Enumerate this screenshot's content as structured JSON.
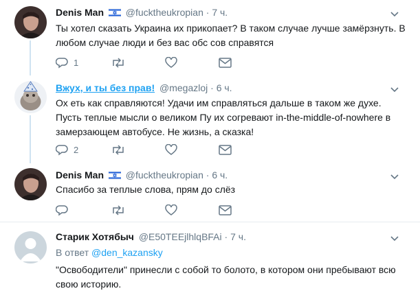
{
  "tweets": [
    {
      "name": "Denis Man",
      "handle": "@fucktheukropian",
      "sep": "·",
      "time": "7 ч.",
      "text": "Ты хотел сказать Украина их прикопает? В таком случае лучше замёрзнуть. В любом случае люди и без вас обс  сов справятся",
      "reply_count": "1",
      "retweet_count": "",
      "like_count": ""
    },
    {
      "name": "Вжух, и ты без прав!",
      "handle": "@megazloj",
      "sep": "·",
      "time": "6 ч.",
      "text": "Ох  еть как справляются! Удачи им справляться дальше в таком же духе. Пусть теплые мысли о великом Пу их согревают in-the-middle-of-nowhere в замерзающем автобусе. Не жизнь, а сказка!",
      "reply_count": "2",
      "retweet_count": "",
      "like_count": ""
    },
    {
      "name": "Denis Man",
      "handle": "@fucktheukropian",
      "sep": "·",
      "time": "6 ч.",
      "text": "Спасибо за теплые слова, прям до слёз",
      "reply_count": "",
      "retweet_count": "",
      "like_count": ""
    },
    {
      "name": "Старик Хотябыч",
      "handle": "@E50TEEjlhlqBFAi",
      "sep": "·",
      "time": "7 ч.",
      "reply_prefix": "В ответ",
      "reply_mention": "@den_kazansky",
      "text": "\"Освободители\" принесли с собой то болото, в котором они пребывают всю свою историю."
    }
  ],
  "icons": {
    "reply": "reply-icon",
    "retweet": "retweet-icon",
    "like": "heart-icon",
    "dm": "envelope-icon",
    "caret": "chevron-down-icon",
    "flag": "israel-flag-icon"
  },
  "colors": {
    "link": "#1da1f2",
    "secondary": "#657786",
    "thread_line": "#cfe3f1",
    "divider": "#e6ecf0"
  }
}
